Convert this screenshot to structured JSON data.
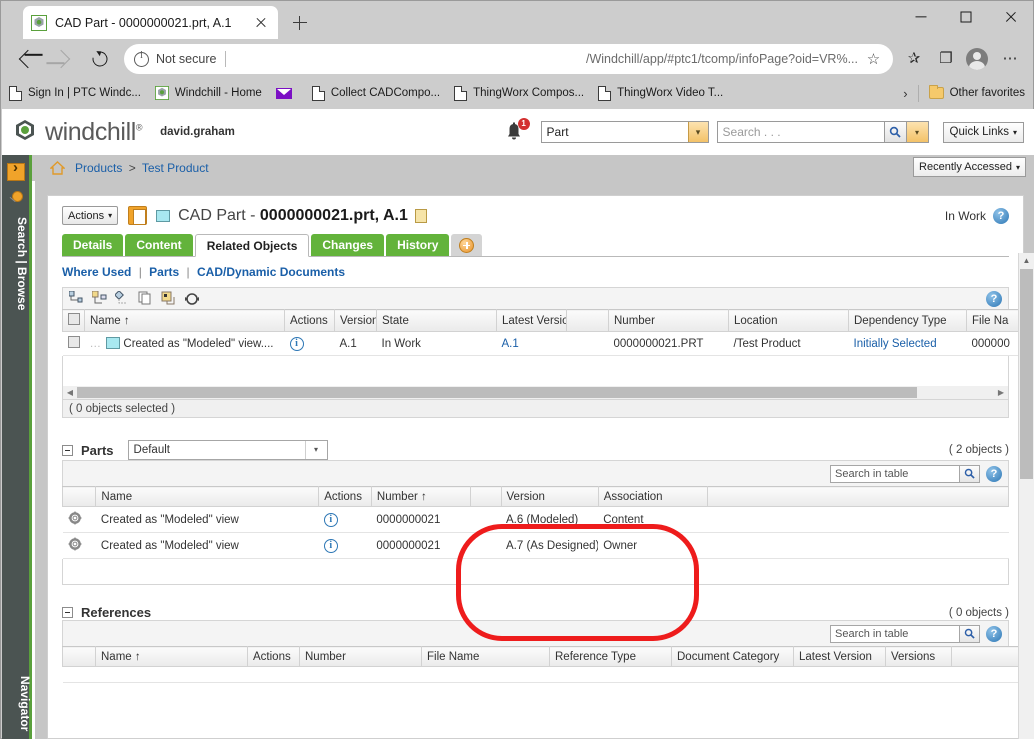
{
  "browser": {
    "tab_title": "CAD Part - 0000000021.prt, A.1",
    "tab_favicon": "windchill-favicon",
    "new_tab_label": "+",
    "window_minimize": "minimize-icon",
    "window_maximize": "maximize-icon",
    "window_close": "close-icon",
    "back_label": "back-arrow-icon",
    "forward_label": "forward-arrow-icon",
    "reload_label": "reload-icon",
    "security_text": "Not secure",
    "url": "/Windchill/app/#ptc1/tcomp/infoPage?oid=VR%...",
    "star_glyph": "☆",
    "collections_glyph": "❐",
    "favorites_glyph": "✰",
    "more_glyph": "⋯",
    "bookmarks": [
      {
        "label": "Sign In | PTC Windc...",
        "icon": "document-icon"
      },
      {
        "label": "Windchill - Home",
        "icon": "windchill-favicon"
      },
      {
        "label": "",
        "icon": "mail-icon"
      },
      {
        "label": "Collect CADCompo...",
        "icon": "document-icon"
      },
      {
        "label": "ThingWorx Compos...",
        "icon": "document-icon"
      },
      {
        "label": "ThingWorx Video T...",
        "icon": "document-icon"
      }
    ],
    "bookmarks_overflow": "›",
    "other_favorites": "Other favorites"
  },
  "header": {
    "logo_text": "windchill",
    "logo_sup": "®",
    "username": "david.graham",
    "bell_badge": "1",
    "type_select_value": "Part",
    "search_placeholder": "Search . . .",
    "quick_links": "Quick Links",
    "caret": "▾"
  },
  "breadcrumb": {
    "home_icon": "home-icon",
    "root": "Products",
    "separator": ">",
    "current": "Test Product",
    "recently_accessed": "Recently Accessed"
  },
  "rail": {
    "toggle_icon": "expand-panel-icon",
    "pin_icon": "pin-icon",
    "search_browse": "Search | Browse",
    "navigator": "Navigator"
  },
  "object": {
    "actions_label": "Actions",
    "title_prefix": "CAD Part - ",
    "title_name": "0000000021.prt, A.1",
    "status": "In Work",
    "help_glyph": "?"
  },
  "tabs": [
    {
      "label": "Details",
      "active": false
    },
    {
      "label": "Content",
      "active": false
    },
    {
      "label": "Related Objects",
      "active": true
    },
    {
      "label": "Changes",
      "active": false
    },
    {
      "label": "History",
      "active": false
    }
  ],
  "sublinks": [
    "Where Used",
    "Parts",
    "CAD/Dynamic Documents"
  ],
  "used_by_table": {
    "toolbar_icons": [
      "expand-all-icon",
      "collapse-all-icon",
      "expand-one-level-icon",
      "copy-icon",
      "insert-icon",
      "refresh-icon"
    ],
    "help_glyph": "?",
    "columns": [
      "",
      "Name",
      "Actions",
      "Version",
      "State",
      "Latest Version",
      "",
      "Number",
      "Location",
      "Dependency Type",
      "File Na"
    ],
    "sort_column": "Name",
    "sort_glyph": "↑",
    "rows": [
      {
        "name": "Created as \"Modeled\" view....",
        "version": "A.1",
        "state": "In Work",
        "latest_version": "A.1",
        "number": "0000000021.PRT",
        "location": "/Test Product",
        "dependency_type": "Initially Selected",
        "file_name": "000000"
      }
    ],
    "selection_status": "( 0 objects selected )"
  },
  "parts_section": {
    "title": "Parts",
    "view_select": "Default",
    "count": "( 2 objects )",
    "search_placeholder": "Search in table",
    "help_glyph": "?",
    "columns": [
      "",
      "Name",
      "Actions",
      "Number",
      "",
      "Version",
      "Association",
      ""
    ],
    "sort_column": "Number",
    "sort_glyph": "↑",
    "rows": [
      {
        "name": "Created as \"Modeled\" view",
        "number": "0000000021",
        "version": "A.6 (Modeled)",
        "association": "Content"
      },
      {
        "name": "Created as \"Modeled\" view",
        "number": "0000000021",
        "version": "A.7 (As Designed)",
        "association": "Owner"
      }
    ]
  },
  "references_section": {
    "title": "References",
    "count": "( 0 objects )",
    "search_placeholder": "Search in table",
    "help_glyph": "?",
    "columns": [
      "",
      "Name",
      "Actions",
      "Number",
      "File Name",
      "Reference Type",
      "Document Category",
      "Latest Version",
      "Versions",
      ""
    ],
    "sort_column": "Name",
    "sort_glyph": "↑",
    "rows": []
  },
  "annotation": {
    "shape": "red-ellipse-highlight",
    "color": "#ee1c1c",
    "targets": [
      "Version",
      "Association"
    ]
  },
  "colors": {
    "accent_green": "#63b33b",
    "link_blue": "#1a5fa8",
    "rail_dark": "#4b5452",
    "annotation_red": "#ee1c1c"
  }
}
